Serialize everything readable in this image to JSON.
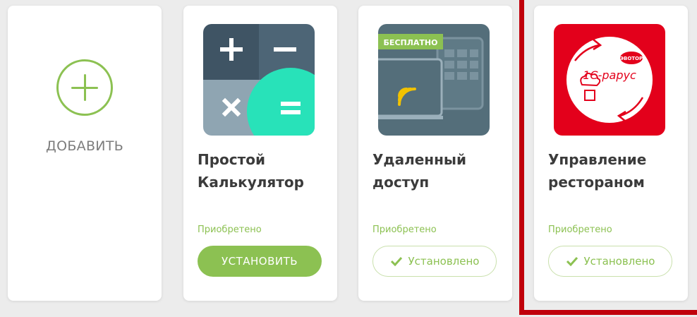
{
  "add_card": {
    "label": "ДОБАВИТЬ"
  },
  "apps": [
    {
      "title_line1": "Простой",
      "title_line2": "Калькулятор",
      "status": "Приобретено",
      "action_label": "УСТАНОВИТЬ",
      "installed": false
    },
    {
      "title_line1": "Удаленный",
      "title_line2": "доступ",
      "status": "Приобретено",
      "action_label": "Установлено",
      "installed": true,
      "badge": "БЕСПЛАТНО"
    },
    {
      "title_line1": "Управление",
      "title_line2": "рестораном",
      "status": "Приобретено",
      "action_label": "Установлено",
      "installed": true,
      "logo_text": "1С-рарус",
      "logo_badge": "ЭВОТОР"
    }
  ],
  "colors": {
    "accent_green": "#8cc152",
    "highlight_red": "#c0000b",
    "calc_dark": "#3f5464",
    "calc_mint": "#28e2b9",
    "remote_slate": "#546e7a",
    "rest_red": "#e3001b"
  },
  "icons": [
    "plus-icon",
    "calculator-icon",
    "remote-access-icon",
    "restaurant-logo-icon",
    "check-icon"
  ]
}
